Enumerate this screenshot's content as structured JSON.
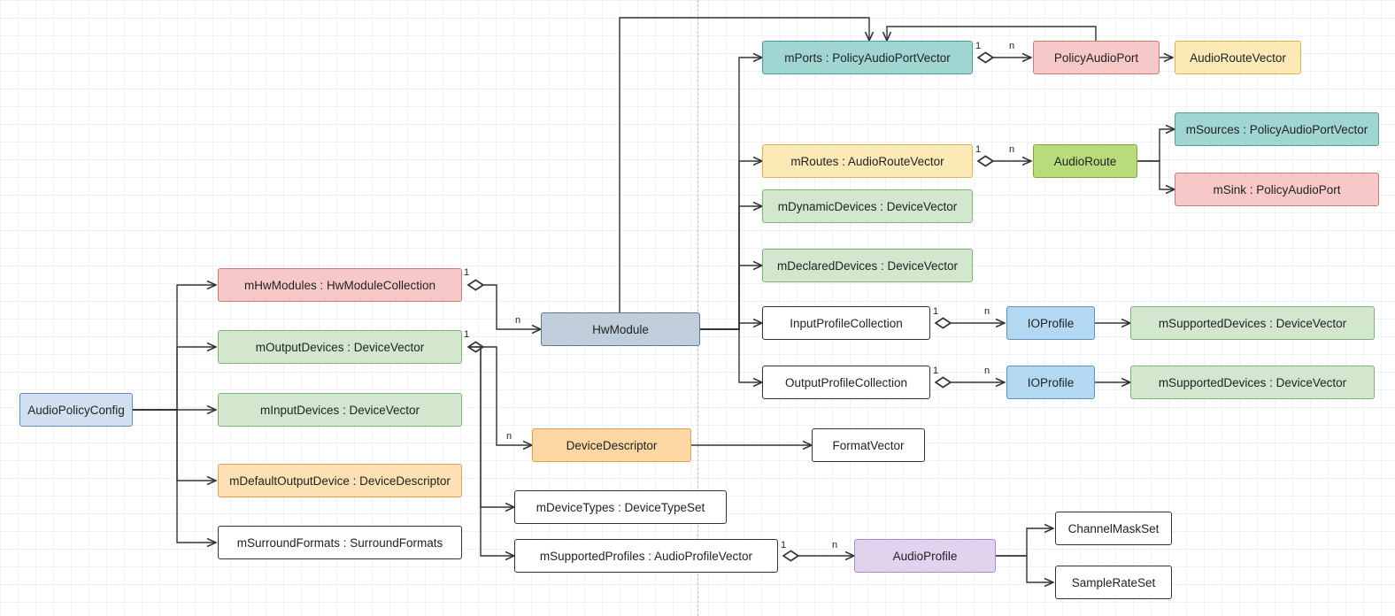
{
  "nodes": {
    "audioPolicyConfig": {
      "label": "AudioPolicyConfig"
    },
    "mHwModules": {
      "label": "mHwModules : HwModuleCollection"
    },
    "mOutputDevices": {
      "label": "mOutputDevices : DeviceVector"
    },
    "mInputDevices": {
      "label": "mInputDevices : DeviceVector"
    },
    "mDefaultOutputDevice": {
      "label": "mDefaultOutputDevice : DeviceDescriptor"
    },
    "mSurroundFormats": {
      "label": "mSurroundFormats : SurroundFormats"
    },
    "hwModule": {
      "label": "HwModule"
    },
    "deviceDescriptor": {
      "label": "DeviceDescriptor"
    },
    "mDeviceTypes": {
      "label": "mDeviceTypes : DeviceTypeSet"
    },
    "mSupportedProfiles": {
      "label": "mSupportedProfiles : AudioProfileVector"
    },
    "mPorts": {
      "label": "mPorts : PolicyAudioPortVector"
    },
    "mRoutes": {
      "label": "mRoutes : AudioRouteVector"
    },
    "mDynamicDevices": {
      "label": "mDynamicDevices : DeviceVector"
    },
    "mDeclaredDevices": {
      "label": "mDeclaredDevices : DeviceVector"
    },
    "inputProfileCollection": {
      "label": "InputProfileCollection"
    },
    "outputProfileCollection": {
      "label": "OutputProfileCollection"
    },
    "formatVector": {
      "label": "FormatVector"
    },
    "policyAudioPort": {
      "label": "PolicyAudioPort"
    },
    "audioRouteVector": {
      "label": "AudioRouteVector"
    },
    "audioRoute": {
      "label": "AudioRoute"
    },
    "mSources": {
      "label": "mSources : PolicyAudioPortVector"
    },
    "mSink": {
      "label": "mSink : PolicyAudioPort"
    },
    "ioProfile1": {
      "label": "IOProfile"
    },
    "ioProfile2": {
      "label": "IOProfile"
    },
    "mSupportedDevices1": {
      "label": "mSupportedDevices : DeviceVector"
    },
    "mSupportedDevices2": {
      "label": "mSupportedDevices : DeviceVector"
    },
    "audioProfile": {
      "label": "AudioProfile"
    },
    "channelMaskSet": {
      "label": "ChannelMaskSet"
    },
    "sampleRateSet": {
      "label": "SampleRateSet"
    }
  },
  "colors": {
    "blueLight": "#d0e0f2",
    "pink": "#f6c9c8",
    "greenPale": "#d2e7ce",
    "orange": "#fde0b3",
    "white": "#ffffff",
    "slate": "#c0cddb",
    "orangeDeep": "#fcd7a4",
    "teal": "#9fd6d2",
    "yellow": "#fbe9b6",
    "green": "#b8db7c",
    "skyBlue": "#b3d9f2",
    "violet": "#e1d2ee"
  },
  "multiplicity": {
    "one": "1",
    "many": "n"
  }
}
